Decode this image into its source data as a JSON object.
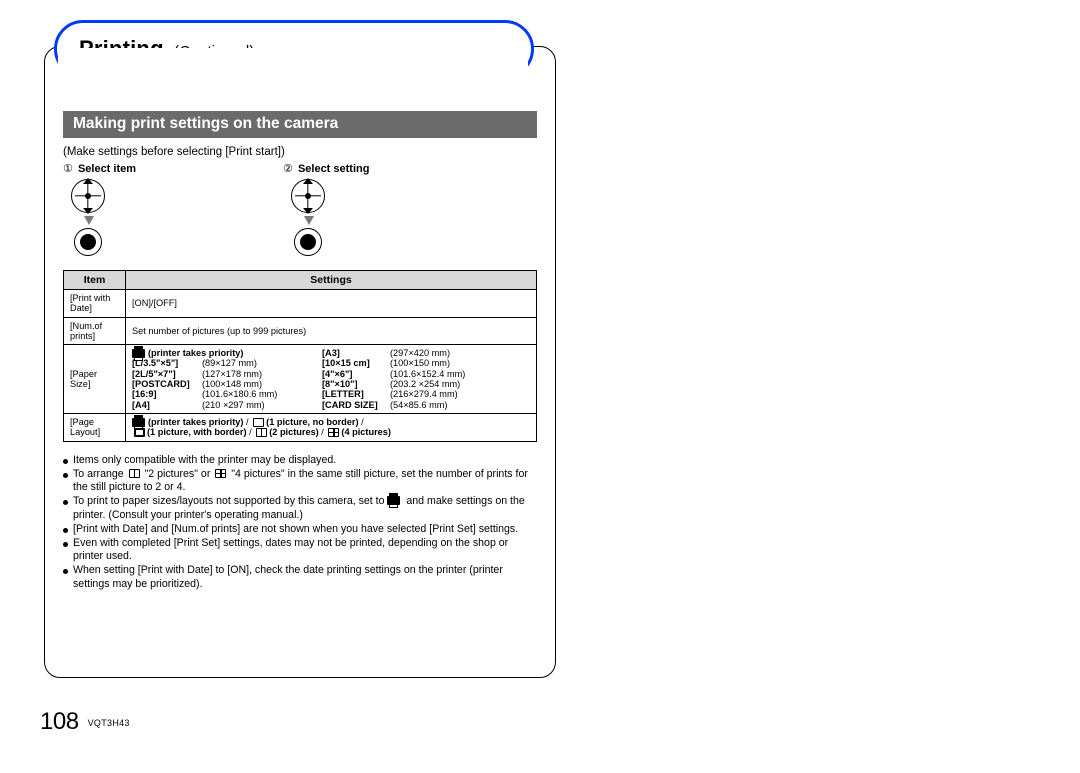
{
  "header": {
    "title": "Printing",
    "subtitle": "(Continued)"
  },
  "section_title": "Making print settings on the camera",
  "intro": "(Make settings before selecting [Print start])",
  "steps": {
    "s1": {
      "num": "①",
      "label": "Select item"
    },
    "s2": {
      "num": "②",
      "label": "Select setting"
    }
  },
  "table": {
    "h_item": "Item",
    "h_settings": "Settings",
    "r1_item": "[Print with Date]",
    "r1_set": "[ON]/[OFF]",
    "r2_item": "[Num.of prints]",
    "r2_set": "Set number of pictures (up to 999 pictures)",
    "r3_item": "[Paper Size]",
    "r3": {
      "priority": "(printer takes priority)",
      "a": {
        "l1": "[L/3.5\"×5\"]",
        "d1": "(89×127 mm)",
        "l2": "[2L/5\"×7\"]",
        "d2": "(127×178 mm)",
        "l3": "[POSTCARD]",
        "d3": "(100×148 mm)",
        "l4": "[16:9]",
        "d4": "(101.6×180.6 mm)",
        "l5": "[A4]",
        "d5": "(210 ×297 mm)"
      },
      "b": {
        "l1": "[A3]",
        "d1": "(297×420 mm)",
        "l2": "[10×15 cm]",
        "d2": "(100×150 mm)",
        "l3": "[4\"×6\"]",
        "d3": "(101.6×152.4 mm)",
        "l4": "[8\"×10\"]",
        "d4": "(203.2 ×254 mm)",
        "l5": "[LETTER]",
        "d5": "(216×279.4 mm)",
        "l6": "[CARD SIZE]",
        "d6": "(54×85.6 mm)"
      }
    },
    "r4_item": "[Page Layout]",
    "r4": {
      "p1": "(printer takes priority)",
      "p2": "(1 picture, no border)",
      "p3": "(1 picture, with border)",
      "p4": "(2 pictures)",
      "p5": "(4 pictures)"
    }
  },
  "notes": {
    "n1": "Items only compatible with the printer may be displayed.",
    "n2a": "To arrange ",
    "n2b": " \"2 pictures\" or ",
    "n2c": " \"4 pictures\" in the same still picture, set the number of prints for the still picture to 2 or 4.",
    "n3a": "To print to paper sizes/layouts not supported by this camera, set to ",
    "n3b": " and make settings on the printer. (Consult your printer's operating manual.)",
    "n4": "[Print with Date] and [Num.of prints] are not shown when you have selected [Print Set] settings.",
    "n5": "Even with completed [Print Set] settings, dates may not be printed, depending on the shop or printer used.",
    "n6": "When setting [Print with Date] to [ON], check the date printing settings on the printer (printer settings may be prioritized)."
  },
  "footer": {
    "page": "108",
    "doc": "VQT3H43"
  }
}
